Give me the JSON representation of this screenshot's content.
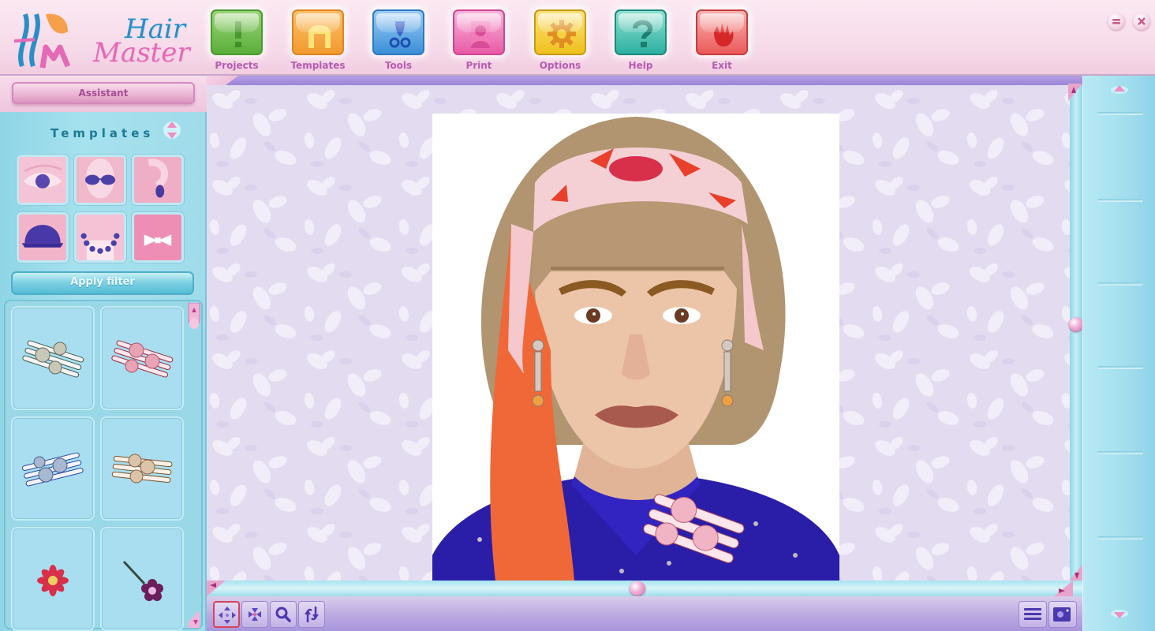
{
  "app": {
    "logo_line1": "Hair",
    "logo_line2": "Master"
  },
  "toolbar": [
    {
      "id": "projects",
      "label": "Projects",
      "icon": "exclamation-icon",
      "color": "#5aae3a"
    },
    {
      "id": "templates",
      "label": "Templates",
      "icon": "hair-icon",
      "color": "#f29a2e"
    },
    {
      "id": "tools",
      "label": "Tools",
      "icon": "scissors-icon",
      "color": "#3a8fd8"
    },
    {
      "id": "print",
      "label": "Print",
      "icon": "portrait-icon",
      "color": "#e85aa6"
    },
    {
      "id": "options",
      "label": "Options",
      "icon": "gear-icon",
      "color": "#f0c01c"
    },
    {
      "id": "help",
      "label": "Help",
      "icon": "question-icon",
      "color": "#2cb0a0"
    },
    {
      "id": "exit",
      "label": "Exit",
      "icon": "hand-icon",
      "color": "#ea5a5a"
    }
  ],
  "window_controls": {
    "minimize": "minimize-icon",
    "close": "close-icon"
  },
  "left_panel": {
    "assistant_label": "Assistant",
    "section_title": "Templates",
    "template_categories": [
      {
        "id": "eyes",
        "label": "Eyes"
      },
      {
        "id": "glasses",
        "label": "Glasses"
      },
      {
        "id": "earrings",
        "label": "Earrings"
      },
      {
        "id": "hats",
        "label": "Hats"
      },
      {
        "id": "necklaces",
        "label": "Necklaces"
      },
      {
        "id": "bows",
        "label": "Bows"
      }
    ],
    "apply_filter_label": "Apply filter",
    "items": [
      {
        "id": "clip-silver-flowers",
        "label": "Silver flower hair clip"
      },
      {
        "id": "clip-pink-flowers",
        "label": "Pink flower hair clip"
      },
      {
        "id": "clip-blue-flowers",
        "label": "Blue flower hair clip"
      },
      {
        "id": "clip-gold-flowers",
        "label": "Gold flower hair clip"
      },
      {
        "id": "red-daisy",
        "label": "Red daisy"
      },
      {
        "id": "flower-pin",
        "label": "Flower hair pin"
      }
    ]
  },
  "canvas": {
    "photo_description": "Woman with bob haircut, floral headscarf, earrings, blue silk top and flower clip"
  },
  "bottom_tools": [
    {
      "id": "move",
      "icon": "move-arrows-icon",
      "active": true
    },
    {
      "id": "shrink",
      "icon": "shrink-arrows-icon",
      "active": false
    },
    {
      "id": "zoom",
      "icon": "magnifier-icon",
      "active": false
    },
    {
      "id": "rotate",
      "icon": "rotate-arrows-icon",
      "active": false
    }
  ],
  "bottom_right_tools": [
    {
      "id": "list",
      "icon": "list-icon"
    },
    {
      "id": "photo",
      "icon": "camera-icon"
    }
  ]
}
